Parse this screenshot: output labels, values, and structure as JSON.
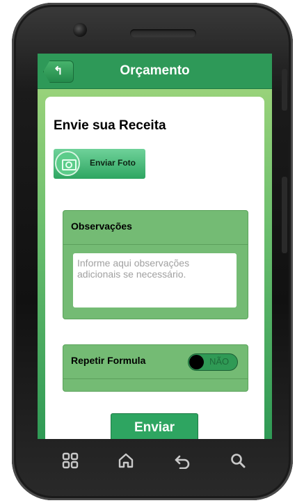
{
  "header": {
    "title": "Orçamento",
    "back_icon": "arrow-left-icon"
  },
  "main": {
    "section_title": "Envie sua Receita",
    "photo_button_label": "Enviar Foto",
    "observacoes": {
      "title": "Observações",
      "placeholder": "Informe aqui observações adicionais se necessário."
    },
    "repetir": {
      "title": "Repetir Formula",
      "toggle_label": "NÃO"
    },
    "send_label": "Enviar"
  },
  "navbar": {
    "icons": [
      "apps-icon",
      "home-icon",
      "back-icon",
      "search-icon"
    ]
  },
  "colors": {
    "accent": "#2e9958",
    "panel": "#74bb74"
  }
}
